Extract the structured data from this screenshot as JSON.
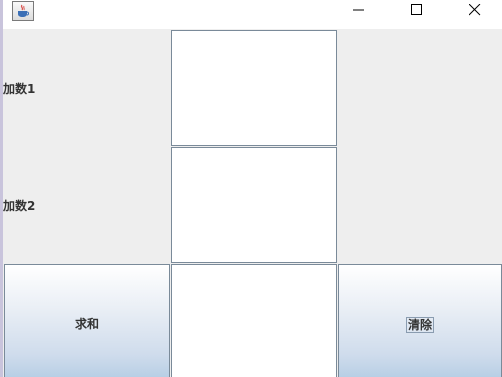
{
  "window": {
    "icon": "java-coffee-cup-icon",
    "controls": {
      "minimize_icon": "minimize-icon",
      "maximize_icon": "maximize-icon",
      "close_icon": "close-icon"
    }
  },
  "form": {
    "label_addend1": "加数1",
    "label_addend2": "加数2",
    "addend1_value": "",
    "addend2_value": "",
    "result_value": "",
    "sum_button_label": "求和",
    "clear_button_label": "清除"
  },
  "colors": {
    "panel_background": "#eeeeee",
    "button_gradient_top": "#ffffff",
    "button_gradient_bottom": "#b8cfe5",
    "field_border": "#7a8a99"
  }
}
